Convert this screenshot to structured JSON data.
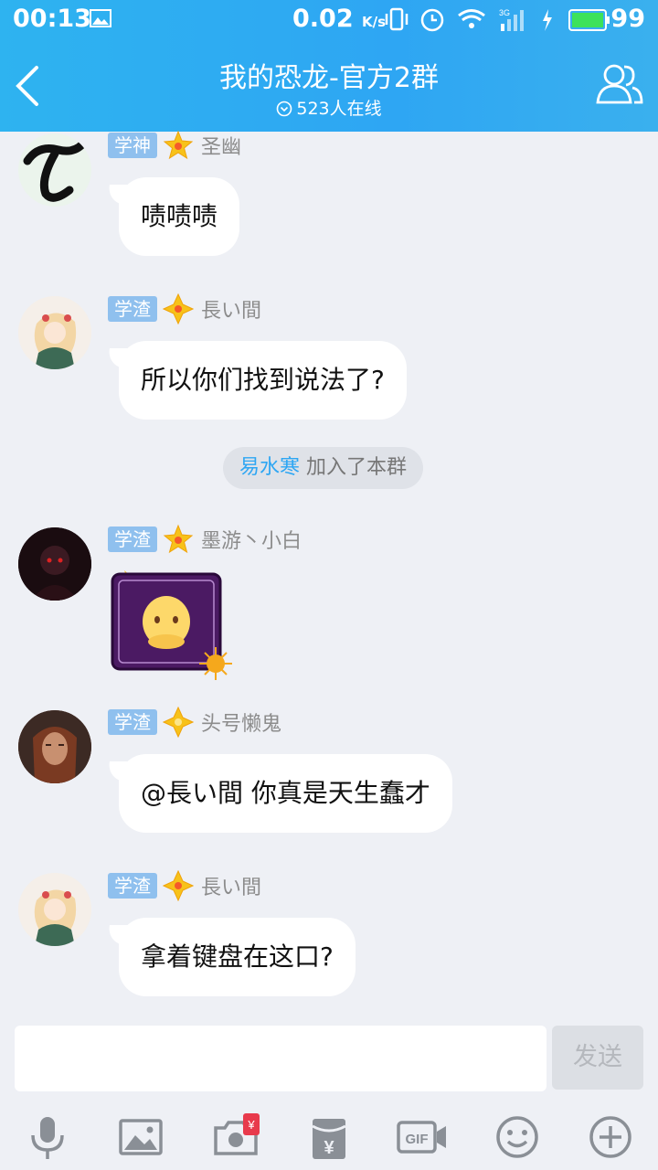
{
  "status": {
    "time": "00:13",
    "net_speed": "0.02",
    "net_unit": "K/s",
    "battery": "99"
  },
  "header": {
    "title": "我的恐龙-官方2群",
    "online": "523人在线"
  },
  "messages": [
    {
      "badge": "学神",
      "name": "圣幽",
      "text": "啧啧啧"
    },
    {
      "badge": "学渣",
      "name": "長い間",
      "text": "所以你们找到说法了?"
    },
    {
      "badge": "学渣",
      "name": "墨游丶小白"
    },
    {
      "badge": "学渣",
      "name": "头号懒鬼",
      "text": "@長い間 你真是天生蠢才"
    },
    {
      "badge": "学渣",
      "name": "長い間",
      "text": "拿着键盘在这口?"
    }
  ],
  "system": {
    "who": "易水寒",
    "action": " 加入了本群"
  },
  "input": {
    "placeholder": "",
    "send_label": "发送"
  },
  "toolbar": [
    "mic-icon",
    "image-icon",
    "camera-icon",
    "red-packet-icon",
    "gif-icon",
    "emoji-icon",
    "plus-icon"
  ],
  "colors": {
    "header": "#2ea6f3",
    "badge": "#8fc0ee",
    "background": "#eef0f5"
  }
}
